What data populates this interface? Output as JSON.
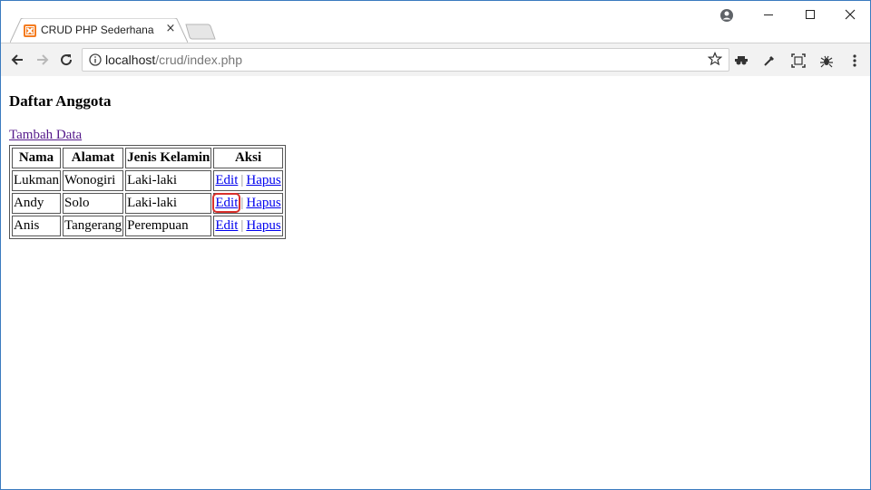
{
  "browser": {
    "tab_title": "CRUD PHP Sederhana",
    "tab_close": "×",
    "url_host": "localhost",
    "url_path": "/crud/index.php"
  },
  "page": {
    "heading": "Daftar Anggota",
    "add_link": "Tambah Data",
    "table": {
      "headers": [
        "Nama",
        "Alamat",
        "Jenis Kelamin",
        "Aksi"
      ],
      "rows": [
        {
          "nama": "Lukman",
          "alamat": "Wonogiri",
          "jk": "Laki-laki",
          "edit": "Edit",
          "sep": "|",
          "hapus": "Hapus"
        },
        {
          "nama": "Andy",
          "alamat": "Solo",
          "jk": "Laki-laki",
          "edit": "Edit",
          "sep": "|",
          "hapus": "Hapus"
        },
        {
          "nama": "Anis",
          "alamat": "Tangerang",
          "jk": "Perempuan",
          "edit": "Edit",
          "sep": "|",
          "hapus": "Hapus"
        }
      ]
    },
    "highlight_color": "#d9302b"
  }
}
